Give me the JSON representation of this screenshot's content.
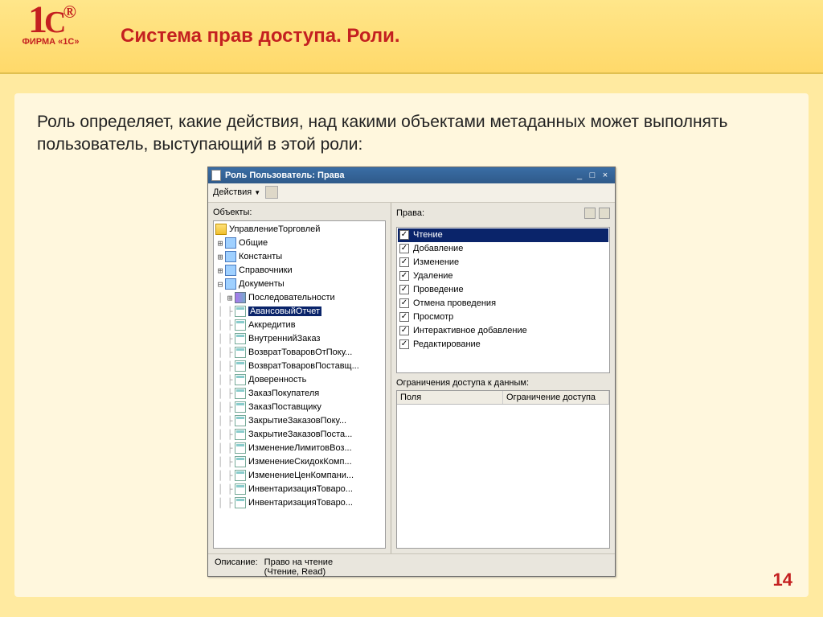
{
  "logo": {
    "main": "1C",
    "caption": "ФИРМА «1С»"
  },
  "slide": {
    "title": "Система прав доступа. Роли.",
    "intro": "Роль определяет, какие действия, над какими объектами метаданных может выполнять пользователь, выступающий в этой роли:",
    "page": "14"
  },
  "window": {
    "title": "Роль Пользователь: Права",
    "menu": "Действия",
    "objects_label": "Объекты:",
    "rights_label": "Права:",
    "restrict_label": "Ограничения доступа к данным:",
    "restrict_cols": {
      "fields": "Поля",
      "rule": "Ограничение доступа"
    },
    "footer_label": "Описание:",
    "footer_value": "Право на чтение\n(Чтение, Read)"
  },
  "tree": {
    "root": "УправлениеТорговлей",
    "groups": [
      {
        "label": "Общие",
        "expandable": true
      },
      {
        "label": "Константы",
        "expandable": true
      },
      {
        "label": "Справочники",
        "expandable": true
      },
      {
        "label": "Документы",
        "expandable": true,
        "expanded": true
      }
    ],
    "docs_header": "Последовательности",
    "docs": [
      "АвансовыйОтчет",
      "Аккредитив",
      "ВнутреннийЗаказ",
      "ВозвратТоваровОтПоку...",
      "ВозвратТоваровПоставщ...",
      "Доверенность",
      "ЗаказПокупателя",
      "ЗаказПоставщику",
      "ЗакрытиеЗаказовПоку...",
      "ЗакрытиеЗаказовПоста...",
      "ИзменениеЛимитовВоз...",
      "ИзменениеСкидокКомп...",
      "ИзменениеЦенКомпани...",
      "ИнвентаризацияТоваро...",
      "ИнвентаризацияТоваро..."
    ],
    "selected_doc_index": 0
  },
  "rights": [
    {
      "label": "Чтение",
      "checked": true,
      "selected": true
    },
    {
      "label": "Добавление",
      "checked": true
    },
    {
      "label": "Изменение",
      "checked": true
    },
    {
      "label": "Удаление",
      "checked": true
    },
    {
      "label": "Проведение",
      "checked": true
    },
    {
      "label": "Отмена проведения",
      "checked": true
    },
    {
      "label": "Просмотр",
      "checked": true
    },
    {
      "label": "Интерактивное добавление",
      "checked": true
    },
    {
      "label": "Редактирование",
      "checked": true
    }
  ]
}
